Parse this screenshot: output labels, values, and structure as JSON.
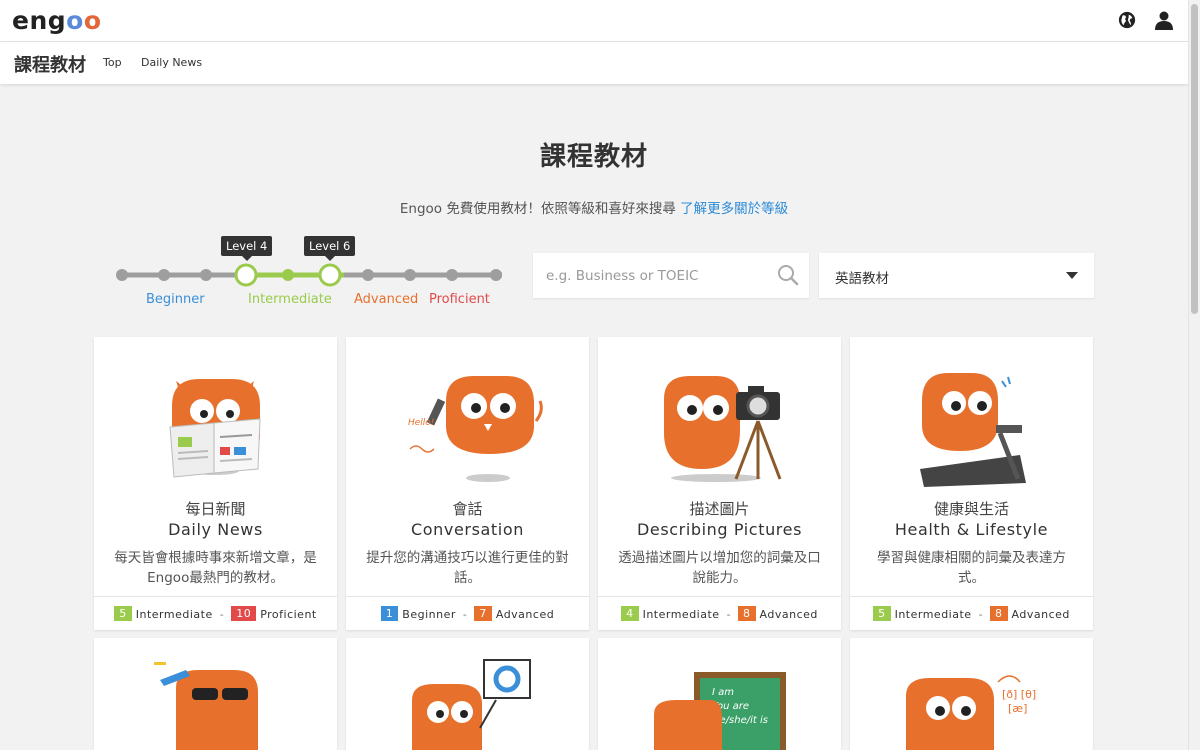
{
  "brand": {
    "prefix": "eng",
    "o1": "o",
    "o2": "o"
  },
  "subnav": {
    "title": "課程教材",
    "links": [
      "Top",
      "Daily News"
    ]
  },
  "page": {
    "title": "課程教材",
    "subtitle": "Engoo 免費使用教材！依照等級和喜好來搜尋 ",
    "subtitle_link": "了解更多關於等級"
  },
  "levels": {
    "selected_low": "Level 4",
    "selected_high": "Level 6",
    "bands": [
      "Beginner",
      "Intermediate",
      "Advanced",
      "Proficient"
    ],
    "colors": {
      "beginner": "#3a8fd8",
      "intermediate": "#9bcb4c",
      "advanced": "#e8702d",
      "proficient": "#e24a4a",
      "track": "#9e9e9e"
    }
  },
  "search": {
    "placeholder": "e.g. Business or TOEIC"
  },
  "language_select": {
    "value": "英語教材"
  },
  "cards": [
    {
      "zh": "每日新聞",
      "en": "Daily News",
      "desc": "每天皆會根據時事來新增文章，是Engoo最熱門的教材。",
      "from_num": "5",
      "from_label": "Intermediate",
      "from_color": "#9bcb4c",
      "to_num": "10",
      "to_label": "Proficient",
      "to_color": "#e24a4a"
    },
    {
      "zh": "會話",
      "en": "Conversation",
      "desc": "提升您的溝通技巧以進行更佳的對話。",
      "from_num": "1",
      "from_label": "Beginner",
      "from_color": "#3a8fd8",
      "to_num": "7",
      "to_label": "Advanced",
      "to_color": "#e8702d",
      "art_text": "Hello!"
    },
    {
      "zh": "描述圖片",
      "en": "Describing Pictures",
      "desc": "透過描述圖片以增加您的詞彙及口說能力。",
      "from_num": "4",
      "from_label": "Intermediate",
      "from_color": "#9bcb4c",
      "to_num": "8",
      "to_label": "Advanced",
      "to_color": "#e8702d"
    },
    {
      "zh": "健康與生活",
      "en": "Health & Lifestyle",
      "desc": "學習與健康相關的詞彙及表達方式。",
      "from_num": "5",
      "from_label": "Intermediate",
      "from_color": "#9bcb4c",
      "to_num": "8",
      "to_label": "Advanced",
      "to_color": "#e8702d"
    }
  ],
  "chalkboard": [
    "I am",
    "You are",
    "He/she/it is"
  ],
  "phonetics": [
    "[ð] [θ]",
    "[æ]"
  ],
  "icons": [
    "globe-icon",
    "user-icon",
    "search-icon",
    "chevron-down-icon"
  ]
}
